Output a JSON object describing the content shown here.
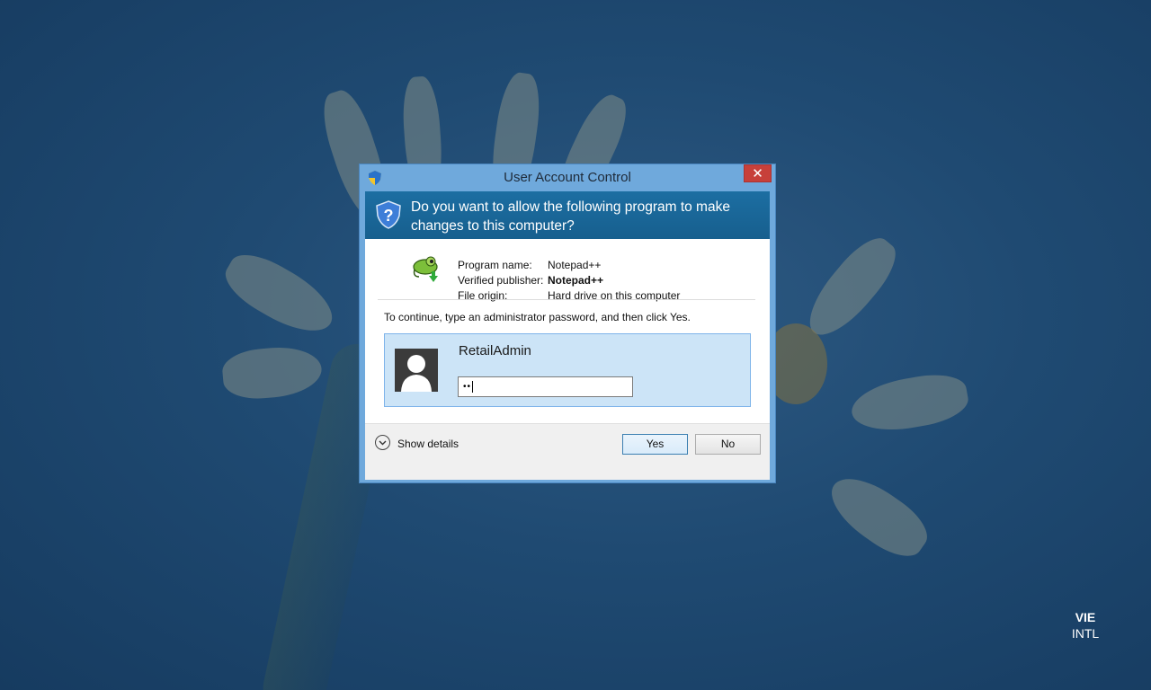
{
  "dialog": {
    "title": "User Account Control",
    "close_glyph": "✕",
    "question": "Do you want to allow the following program to make changes to this computer?",
    "program": {
      "icon": "notepad-plus-plus-chameleon-icon",
      "rows": [
        {
          "label": "Program name:",
          "value": "Notepad++"
        },
        {
          "label": "Verified publisher:",
          "value": "Notepad++"
        },
        {
          "label": "File origin:",
          "value": "Hard drive on this computer"
        }
      ]
    },
    "instruction": "To continue, type an administrator password, and then click Yes.",
    "credential": {
      "username": "RetailAdmin",
      "password_masked": "••"
    },
    "details_label": "Show details",
    "yes_label": "Yes",
    "no_label": "No"
  },
  "language_indicator": {
    "code": "VIE",
    "layout": "INTL"
  },
  "colors": {
    "titlebar": "#6fa9dc",
    "question_band": "#1c6ea2",
    "credential_tile": "#cce4f7",
    "close_button": "#c7403a"
  }
}
